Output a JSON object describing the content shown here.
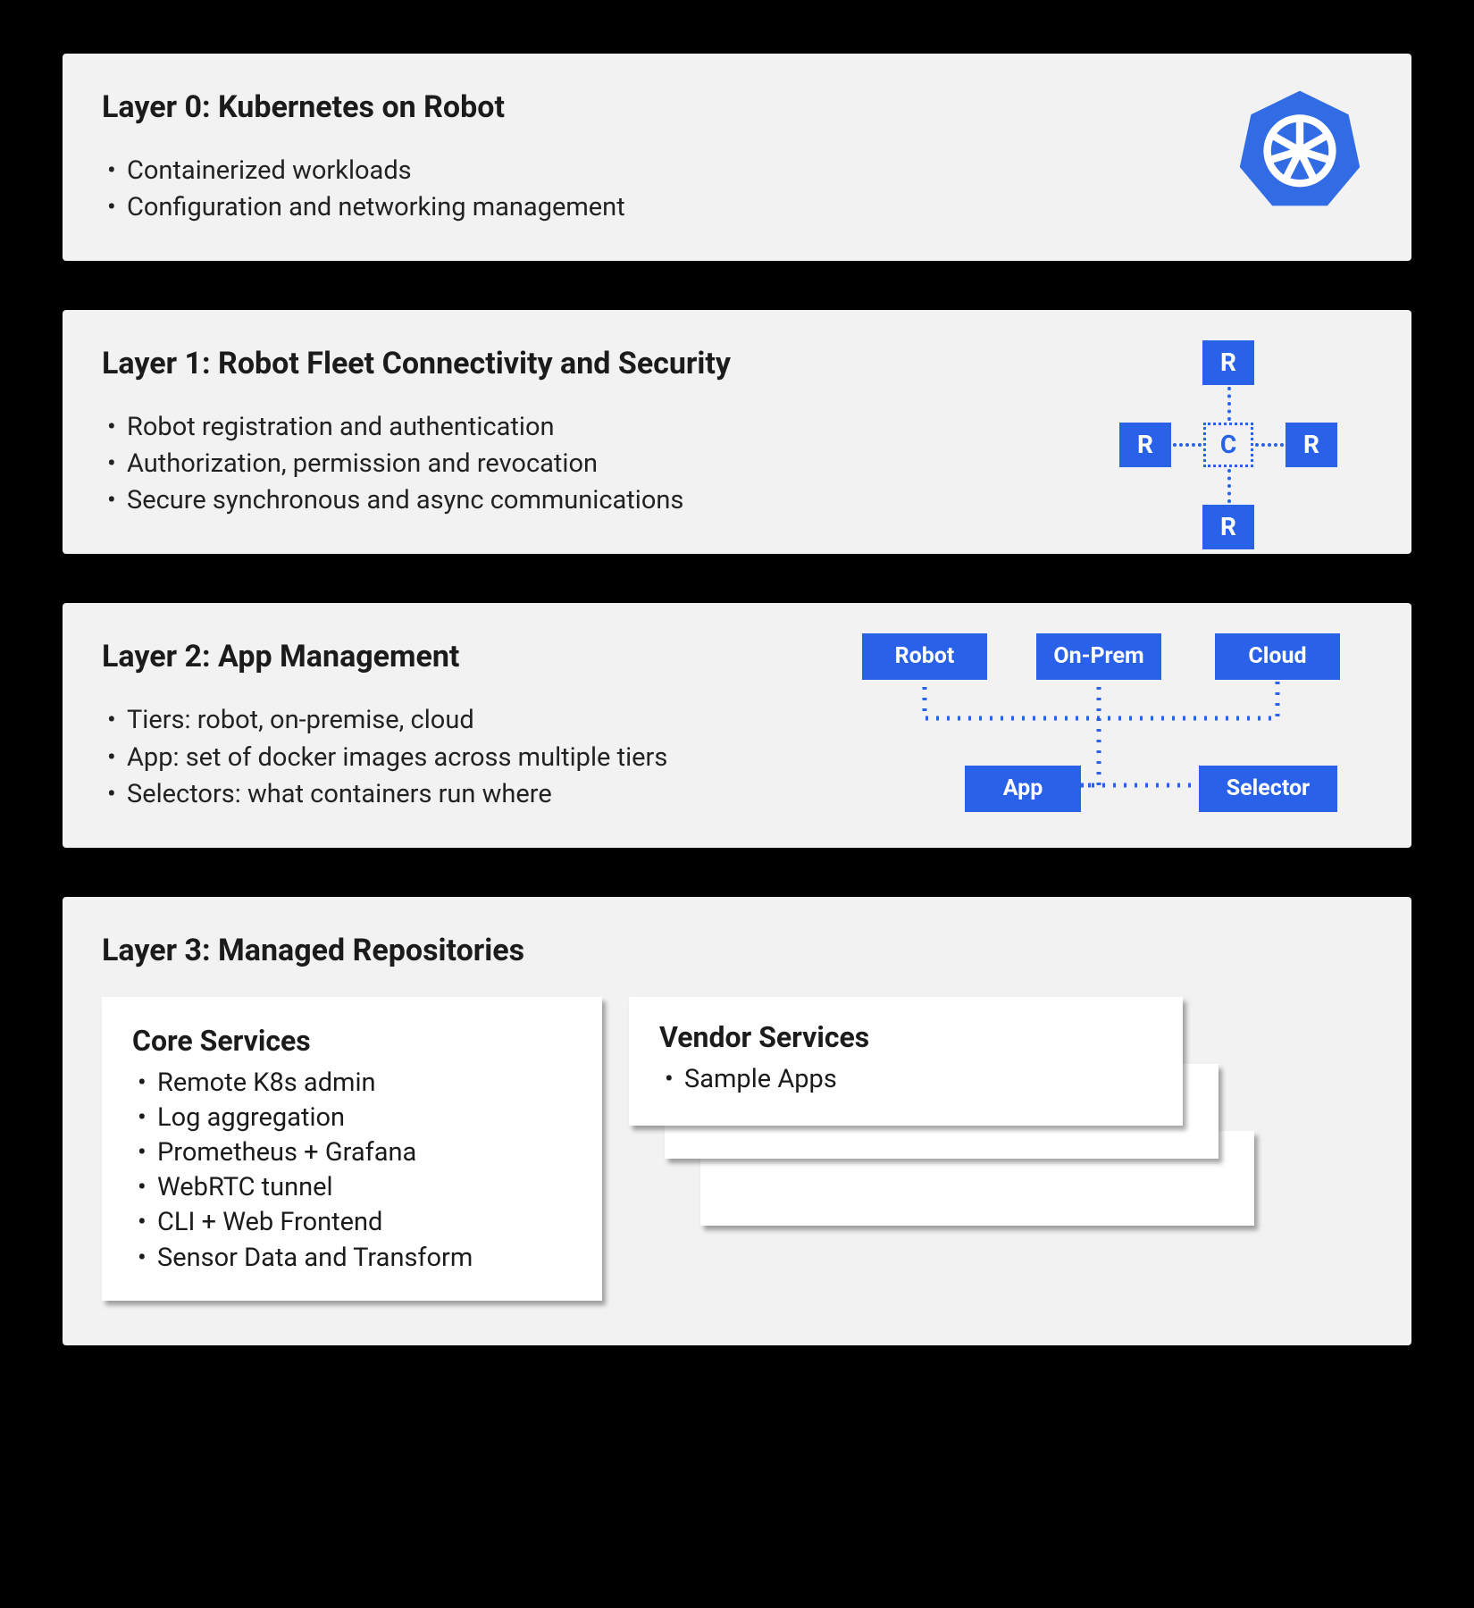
{
  "accent": "#2962e8",
  "layers": [
    {
      "title": "Layer 0: Kubernetes on Robot",
      "bullets": [
        "Containerized workloads",
        "Configuration and networking management"
      ],
      "icon": "kubernetes-logo"
    },
    {
      "title": "Layer 1: Robot Fleet Connectivity and Security",
      "bullets": [
        "Robot registration and authentication",
        "Authorization, permission and revocation",
        "Secure synchronous and async communications"
      ],
      "hubspoke": {
        "center": "C",
        "spokes": [
          "R",
          "R",
          "R",
          "R"
        ]
      }
    },
    {
      "title": "Layer 2: App Management",
      "bullets": [
        "Tiers: robot, on-premise, cloud",
        "App: set of docker images across multiple tiers",
        "Selectors: what containers run where"
      ],
      "arch_nodes": {
        "robot": "Robot",
        "onprem": "On-Prem",
        "cloud": "Cloud",
        "app": "App",
        "selector": "Selector"
      }
    },
    {
      "title": "Layer 3: Managed Repositories",
      "core": {
        "title": "Core Services",
        "bullets": [
          "Remote K8s admin",
          "Log aggregation",
          "Prometheus + Grafana",
          "WebRTC tunnel",
          "CLI + Web Frontend",
          "Sensor Data and Transform"
        ]
      },
      "vendor": {
        "title": "Vendor Services",
        "bullets": [
          "Sample Apps"
        ]
      }
    }
  ]
}
